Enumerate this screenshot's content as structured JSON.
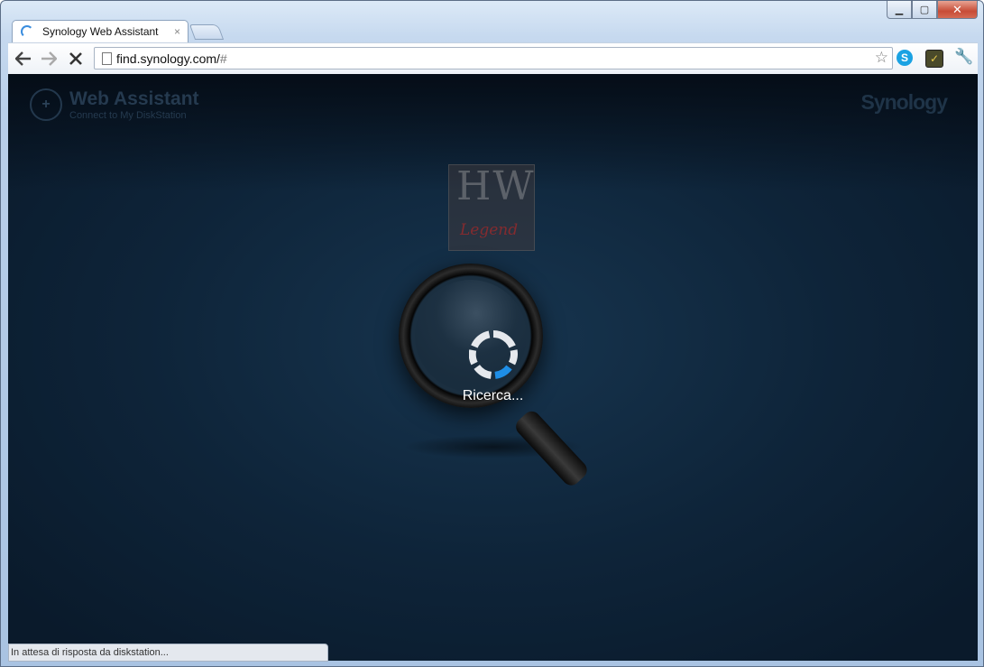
{
  "browser": {
    "tab_title": "Synology Web Assistant",
    "tab_close": "×",
    "url_main": "find.synology.com/",
    "url_hash": "#",
    "status_text": "In attesa di risposta da diskstation..."
  },
  "icons": {
    "back": "arrow-left-icon",
    "forward": "arrow-right-icon",
    "stop": "close-x-icon",
    "bookmark": "star-icon",
    "settings": "wrench-icon"
  },
  "page": {
    "app_title": "Web Assistant",
    "app_subtitle": "Connect to My DiskStation",
    "brand": "Synology",
    "watermark_top": "HW",
    "watermark_bottom": "Legend",
    "searching_text": "Ricerca..."
  },
  "colors": {
    "accent": "#1e8ee6",
    "background": "#0e2439"
  }
}
